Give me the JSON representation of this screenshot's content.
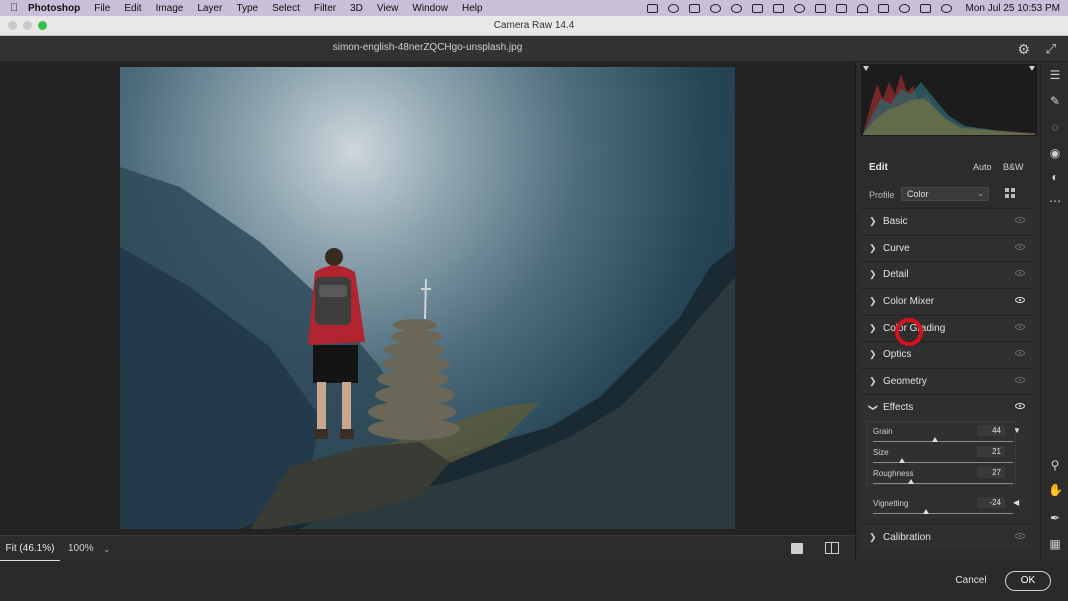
{
  "menubar": {
    "app_name": "Photoshop",
    "menus": [
      "File",
      "Edit",
      "Image",
      "Layer",
      "Type",
      "Select",
      "Filter",
      "3D",
      "View",
      "Window",
      "Help"
    ],
    "clock": "Mon Jul 25  10:53 PM"
  },
  "window": {
    "title": "Camera Raw 14.4",
    "filename": "simon-english-48nerZQCHgo-unsplash.jpg"
  },
  "statusbar": {
    "fit_label": "Fit (46.1%)",
    "zoom_label": "100%"
  },
  "panel": {
    "edit_title": "Edit",
    "auto_label": "Auto",
    "bw_label": "B&W",
    "profile_label": "Profile",
    "profile_value": "Color",
    "sections": {
      "basic": "Basic",
      "curve": "Curve",
      "detail": "Detail",
      "color_mixer": "Color Mixer",
      "color_grading": "Color Grading",
      "optics": "Optics",
      "geometry": "Geometry",
      "effects": "Effects",
      "calibration": "Calibration"
    },
    "effects": {
      "grain": {
        "label": "Grain",
        "value": "44",
        "fraction": 0.44
      },
      "size": {
        "label": "Size",
        "value": "21",
        "fraction": 0.21
      },
      "roughness": {
        "label": "Roughness",
        "value": "27",
        "fraction": 0.27
      },
      "vignetting": {
        "label": "Vignetting",
        "value": "-24",
        "fraction": 0.38
      }
    }
  },
  "footer": {
    "cancel_label": "Cancel",
    "ok_label": "OK"
  },
  "colors": {
    "accent_red": "#d6121b",
    "panel_bg": "#2c2c2c"
  }
}
